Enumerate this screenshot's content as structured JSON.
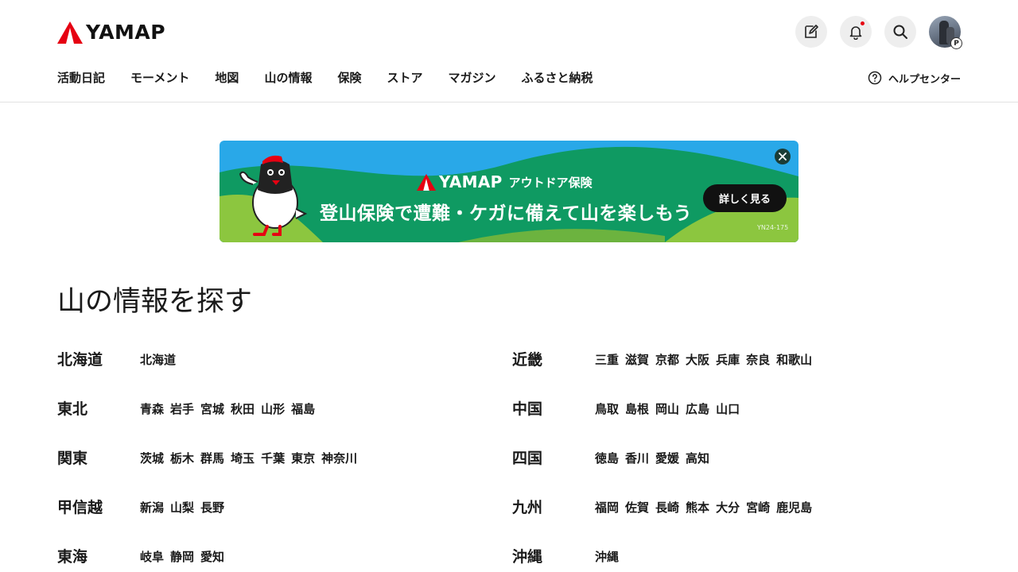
{
  "header": {
    "logo_text": "YAMAP",
    "nav": [
      "活動日記",
      "モーメント",
      "地図",
      "山の情報",
      "保険",
      "ストア",
      "マガジン",
      "ふるさと納税"
    ],
    "help_label": "ヘルプセンター",
    "avatar_badge": "P",
    "icons": [
      "edit-icon",
      "bell-icon",
      "search-icon",
      "help-circle-icon"
    ]
  },
  "banner": {
    "brand_name": "YAMAP",
    "brand_sub": "アウトドア保険",
    "headline": "登山保険で遭難・ケガに備えて山を楽しもう",
    "cta": "詳しく見る",
    "code": "YN24-175"
  },
  "main": {
    "title": "山の情報を探す",
    "left_regions": [
      {
        "name": "北海道",
        "prefectures": [
          "北海道"
        ]
      },
      {
        "name": "東北",
        "prefectures": [
          "青森",
          "岩手",
          "宮城",
          "秋田",
          "山形",
          "福島"
        ]
      },
      {
        "name": "関東",
        "prefectures": [
          "茨城",
          "栃木",
          "群馬",
          "埼玉",
          "千葉",
          "東京",
          "神奈川"
        ]
      },
      {
        "name": "甲信越",
        "prefectures": [
          "新潟",
          "山梨",
          "長野"
        ]
      },
      {
        "name": "東海",
        "prefectures": [
          "岐阜",
          "静岡",
          "愛知"
        ]
      }
    ],
    "right_regions": [
      {
        "name": "近畿",
        "prefectures": [
          "三重",
          "滋賀",
          "京都",
          "大阪",
          "兵庫",
          "奈良",
          "和歌山"
        ]
      },
      {
        "name": "中国",
        "prefectures": [
          "鳥取",
          "島根",
          "岡山",
          "広島",
          "山口"
        ]
      },
      {
        "name": "四国",
        "prefectures": [
          "徳島",
          "香川",
          "愛媛",
          "高知"
        ]
      },
      {
        "name": "九州",
        "prefectures": [
          "福岡",
          "佐賀",
          "長崎",
          "熊本",
          "大分",
          "宮崎",
          "鹿児島"
        ]
      },
      {
        "name": "沖縄",
        "prefectures": [
          "沖縄"
        ]
      }
    ]
  },
  "colors": {
    "brand_red": "#e60012",
    "banner_sky": "#29a8e8",
    "banner_green": "#1f9a5a",
    "text": "#1a1a1a"
  }
}
